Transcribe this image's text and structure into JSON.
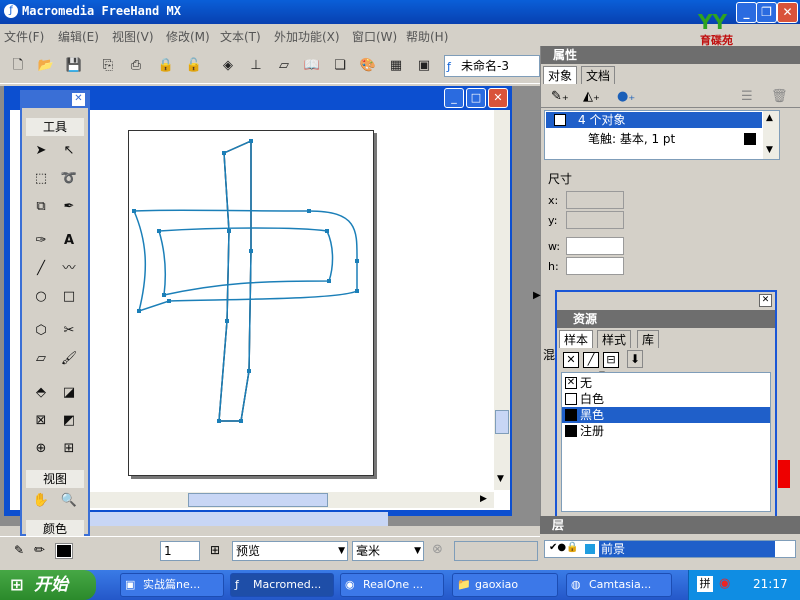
{
  "app": {
    "title": "Macromedia FreeHand MX",
    "logo_text": "育碟苑"
  },
  "menu": [
    "文件(F)",
    "编辑(E)",
    "视图(V)",
    "修改(M)",
    "文本(T)",
    "外加功能(X)",
    "窗口(W)",
    "帮助(H)"
  ],
  "toolbar": {
    "doc_name": "未命名-3"
  },
  "tools_panel": {
    "header": "工具",
    "view_label": "视图",
    "color_label": "颜色"
  },
  "properties": {
    "title": "属性",
    "tabs": [
      "对象",
      "文档"
    ],
    "objects_count": "4 个对象",
    "stroke_info": "笔触: 基本, 1 pt",
    "size_label": "尺寸",
    "x_label": "x:",
    "y_label": "y:",
    "w_label": "w:",
    "h_label": "h:"
  },
  "resources": {
    "title": "资源",
    "tabs": [
      "样本",
      "样式",
      "库"
    ],
    "items": [
      {
        "label": "无",
        "color": "#ffffff"
      },
      {
        "label": "白色",
        "color": "#ffffff"
      },
      {
        "label": "黑色",
        "color": "#000000"
      },
      {
        "label": "注册",
        "color": "#000000"
      }
    ],
    "selected": "黑色",
    "partial_label": "混"
  },
  "layers": {
    "title": "层",
    "item": "前景"
  },
  "statusbar": {
    "page_field": "1",
    "view_mode": "预览",
    "units": "毫米"
  },
  "taskbar": {
    "start": "开始",
    "tasks": [
      "实战篇ne...",
      "Macromed...",
      "RealOne ...",
      "gaoxiao",
      "Camtasia..."
    ],
    "active_task": "Macromed...",
    "time": "21:17",
    "tray_label": "拼"
  }
}
